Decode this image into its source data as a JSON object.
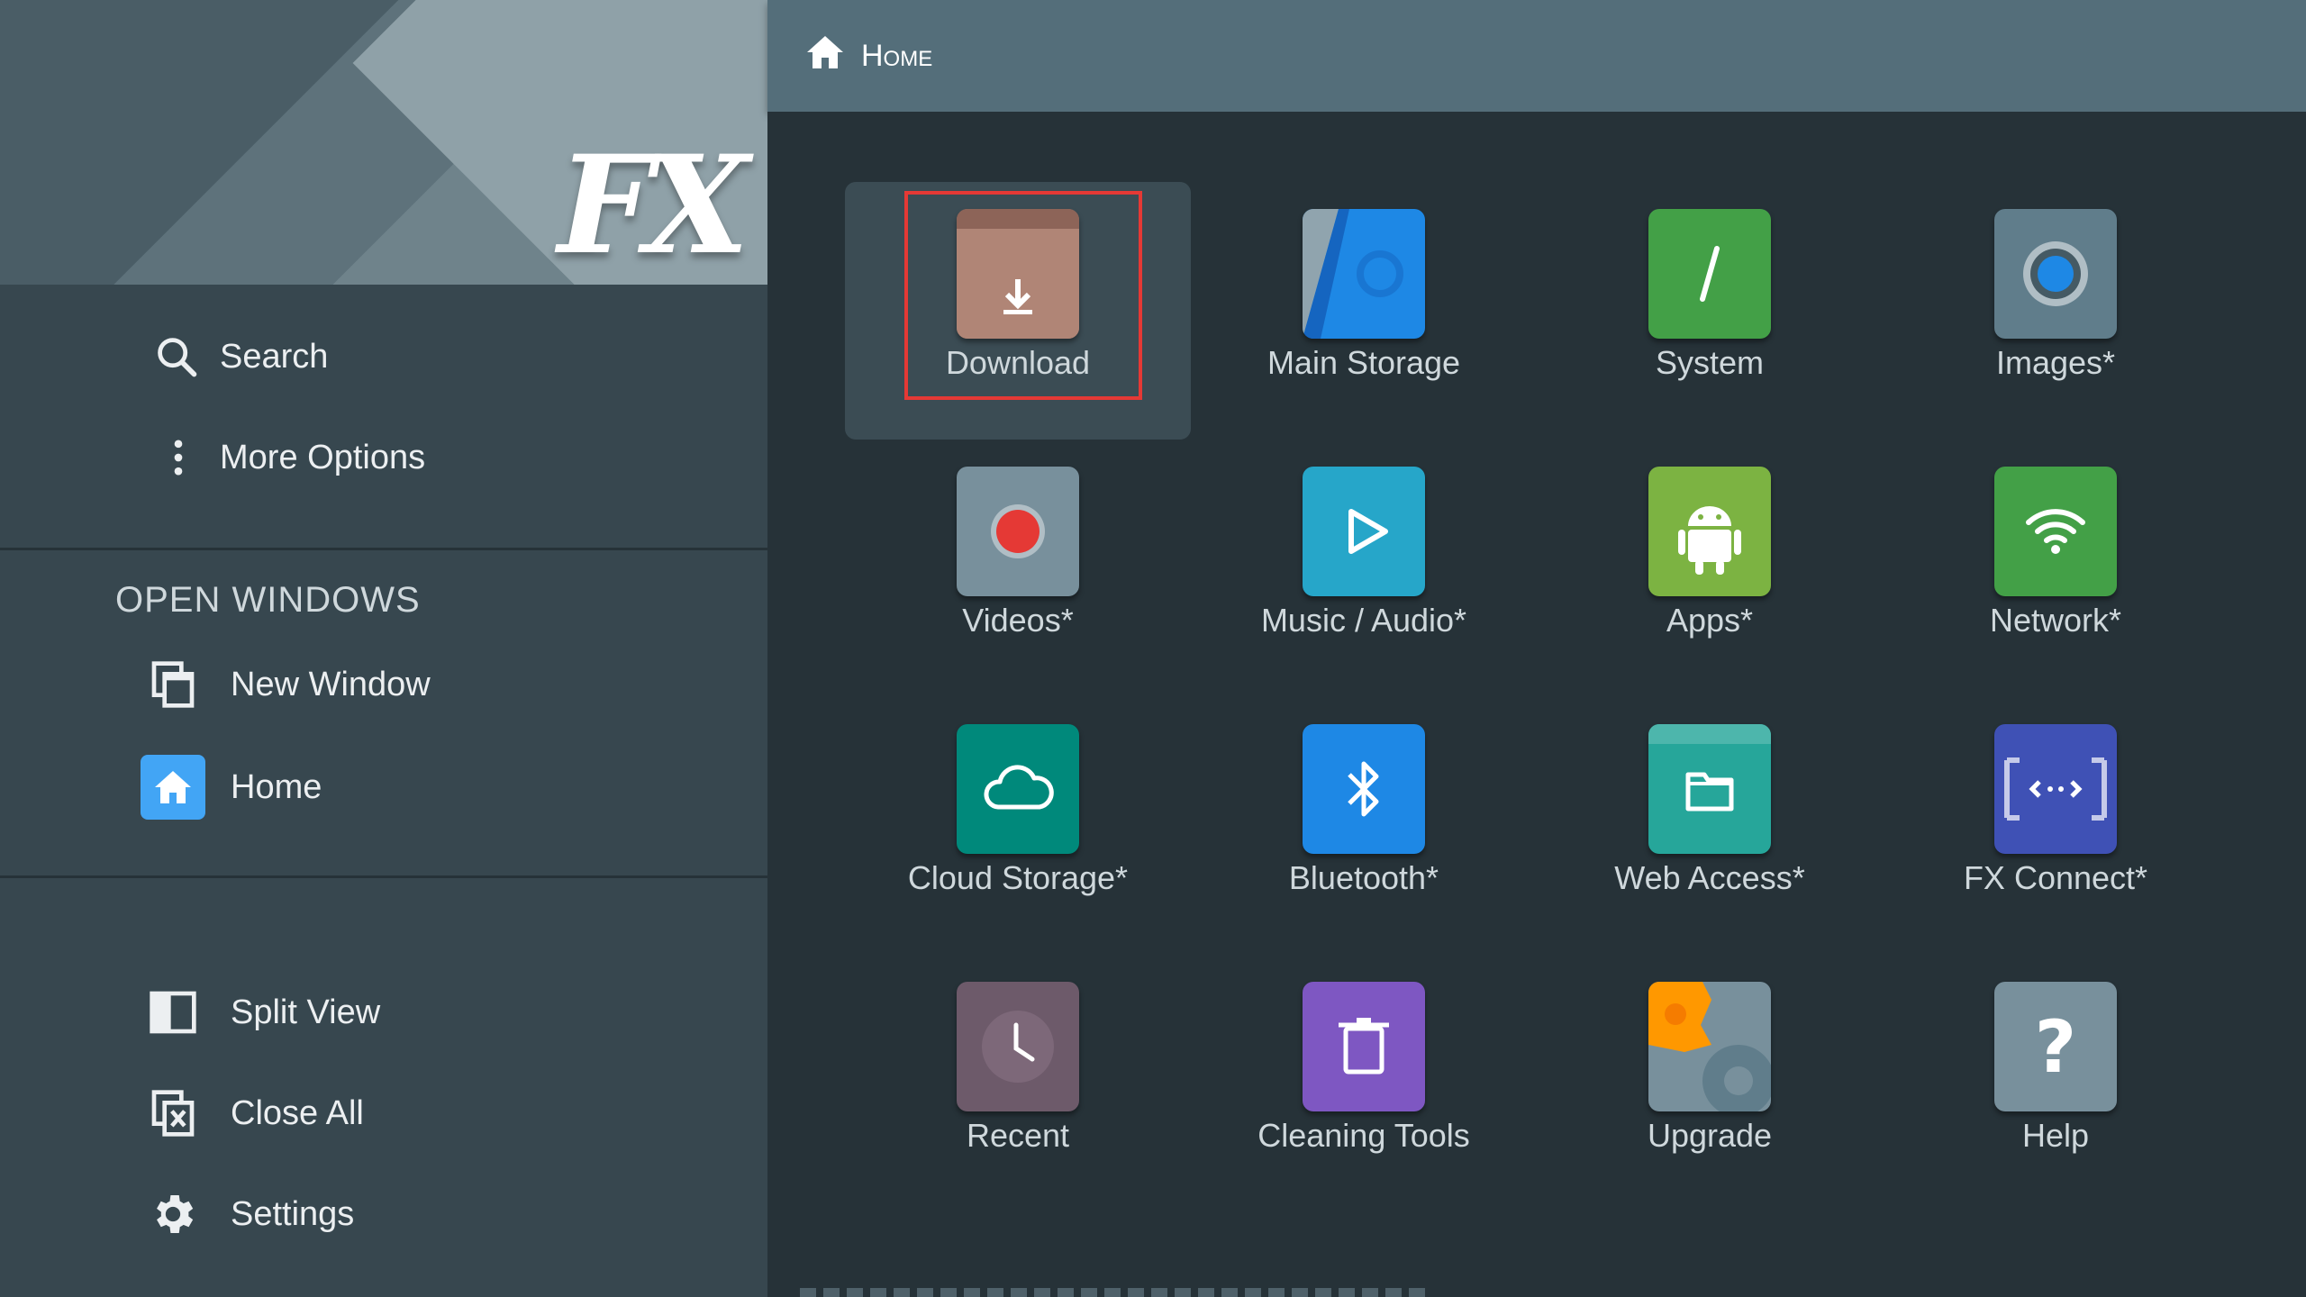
{
  "sidebar": {
    "logo_text": "FX",
    "search_label": "Search",
    "more_options_label": "More Options",
    "open_windows_heading": "OPEN WINDOWS",
    "new_window_label": "New Window",
    "home_label": "Home",
    "split_view_label": "Split View",
    "close_all_label": "Close All",
    "settings_label": "Settings"
  },
  "topbar": {
    "breadcrumb_label": "Home"
  },
  "tiles": [
    {
      "label": "Download",
      "icon": "download-folder-icon",
      "color": "#a1776a",
      "selected": true,
      "highlighted": true
    },
    {
      "label": "Main Storage",
      "icon": "storage-icon",
      "color": "#1e88e5"
    },
    {
      "label": "System",
      "icon": "system-slash-icon",
      "color": "#43a047"
    },
    {
      "label": "Images*",
      "icon": "camera-lens-icon",
      "color": "#607d8b"
    },
    {
      "label": "Videos*",
      "icon": "record-icon",
      "color": "#78909c"
    },
    {
      "label": "Music / Audio*",
      "icon": "play-icon",
      "color": "#26a6c9"
    },
    {
      "label": "Apps*",
      "icon": "android-icon",
      "color": "#7cb342"
    },
    {
      "label": "Network*",
      "icon": "wifi-icon",
      "color": "#43a047"
    },
    {
      "label": "Cloud Storage*",
      "icon": "cloud-icon",
      "color": "#00897b"
    },
    {
      "label": "Bluetooth*",
      "icon": "bluetooth-icon",
      "color": "#1e88e5"
    },
    {
      "label": "Web Access*",
      "icon": "web-folder-icon",
      "color": "#26a69a"
    },
    {
      "label": "FX Connect*",
      "icon": "connect-icon",
      "color": "#3f51b5"
    },
    {
      "label": "Recent",
      "icon": "clock-icon",
      "color": "#6d5a6a"
    },
    {
      "label": "Cleaning Tools",
      "icon": "trash-icon",
      "color": "#7e57c2"
    },
    {
      "label": "Upgrade",
      "icon": "upgrade-gear-icon",
      "color": "#78909c"
    },
    {
      "label": "Help",
      "icon": "help-icon",
      "color": "#78909c"
    }
  ]
}
